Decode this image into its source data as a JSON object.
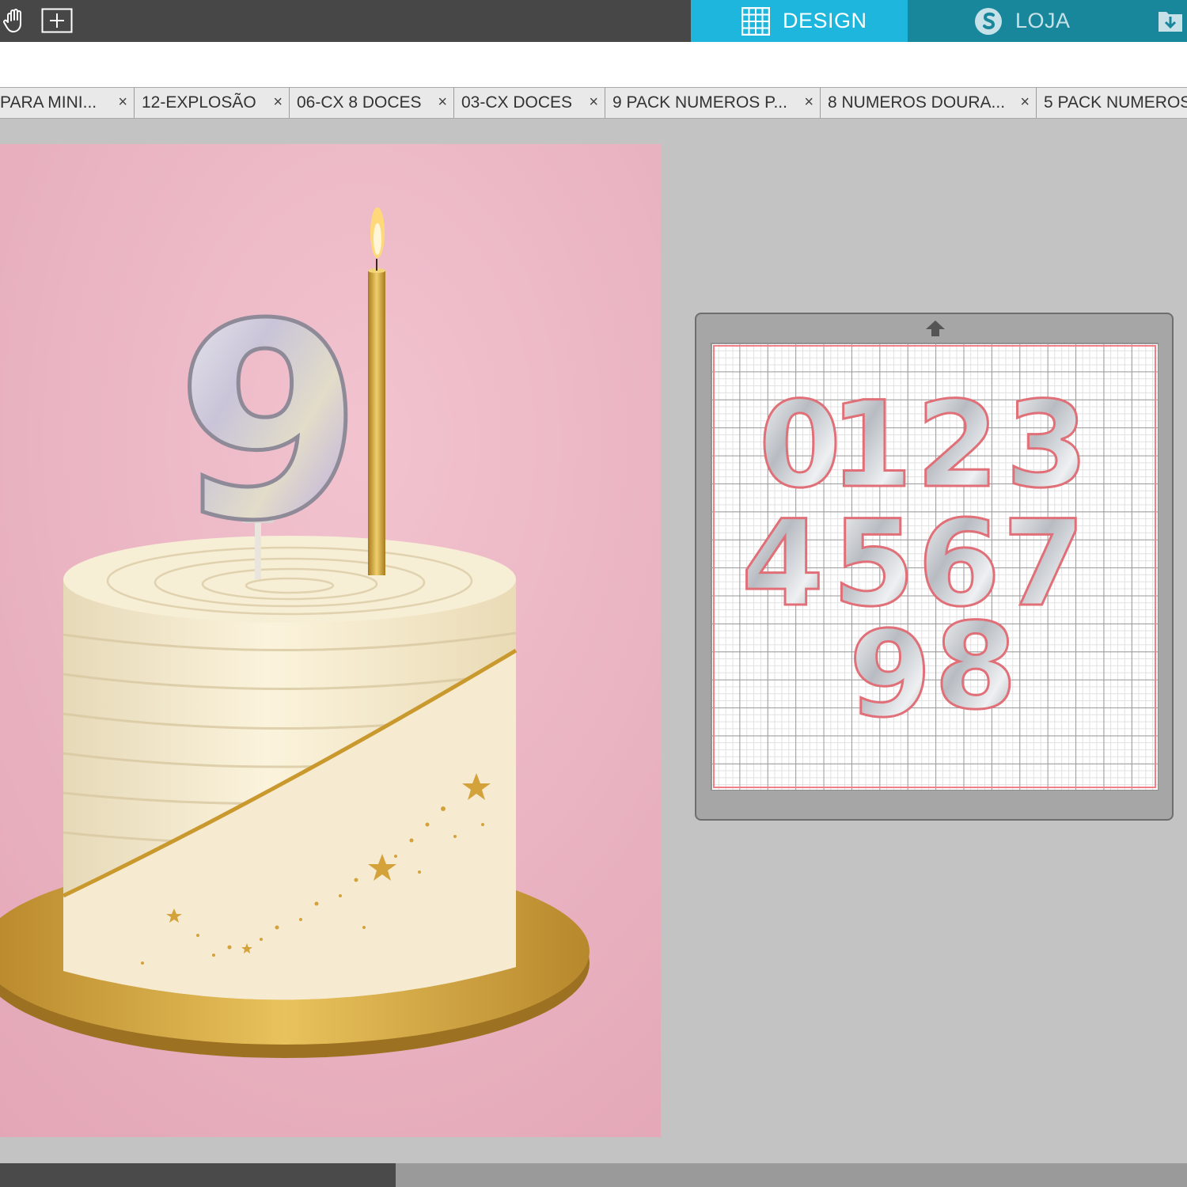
{
  "toolbar": {
    "tools": [
      {
        "icon": "hand-icon"
      },
      {
        "icon": "add-box-icon"
      }
    ]
  },
  "modes": {
    "design_label": "DESIGN",
    "design_icon": "grid-icon",
    "store_label": "LOJA",
    "store_icon": "silhouette-s-icon",
    "library_icon": "folder-download-icon"
  },
  "documents": [
    {
      "label": "PARA MINI...",
      "close": "×"
    },
    {
      "label": "12-EXPLOSÃO",
      "close": "×"
    },
    {
      "label": "06-CX 8 DOCES",
      "close": "×"
    },
    {
      "label": "03-CX DOCES",
      "close": "×"
    },
    {
      "label": "9 PACK NUMEROS P...",
      "close": "×"
    },
    {
      "label": "8 NUMEROS DOURA...",
      "close": "×"
    },
    {
      "label": "5 PACK NUMEROS",
      "close": ""
    }
  ],
  "canvas": {
    "image": "cake-photo-with-number-nine-balloon-candle",
    "mat_digits": [
      "0",
      "1",
      "2",
      "3",
      "4",
      "5",
      "6",
      "7",
      "9",
      "8"
    ]
  },
  "colors": {
    "topbar": "#474747",
    "design_tab": "#1eb6dd",
    "store_tab": "#18869b",
    "workspace": "#c3c3c3",
    "mat_margin": "#f07f86"
  }
}
